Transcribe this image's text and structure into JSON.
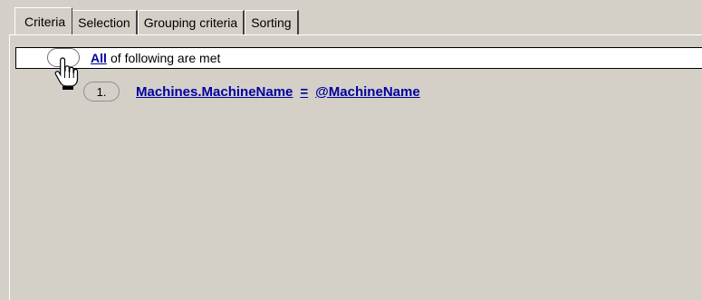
{
  "tabs": [
    {
      "label": "Criteria"
    },
    {
      "label": "Selection"
    },
    {
      "label": "Grouping criteria"
    },
    {
      "label": "Sorting"
    }
  ],
  "root": {
    "quantifier": "All",
    "text": "of following are met"
  },
  "conditions": [
    {
      "number": "1.",
      "field": "Machines.MachineName",
      "operator": "=",
      "value": "@MachineName"
    }
  ],
  "cursor": "hand-pointer-icon"
}
